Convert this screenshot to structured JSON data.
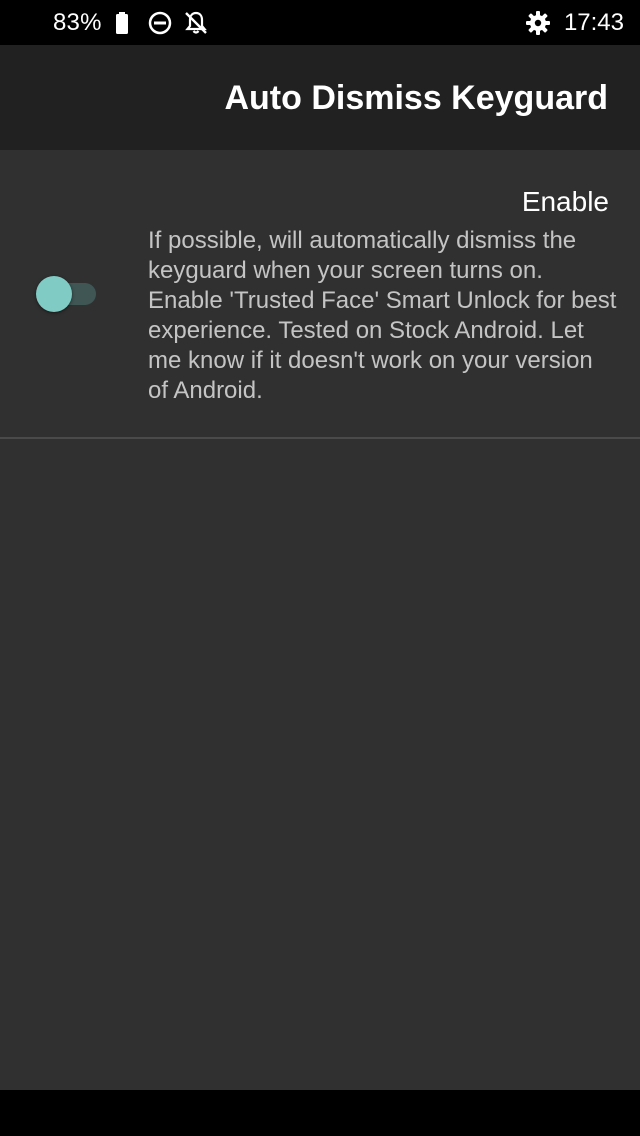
{
  "status_bar": {
    "battery_percent": "83%",
    "time": "17:43",
    "icons": [
      "battery-icon",
      "do-not-disturb-icon",
      "notifications-off-icon",
      "settings-gear-icon"
    ]
  },
  "app_bar": {
    "title": "Auto Dismiss Keyguard"
  },
  "preference": {
    "title": "Enable",
    "summary": "If possible, will automatically dismiss the keyguard when your screen turns on. Enable 'Trusted Face' Smart Unlock for best experience. Tested on Stock Android. Let me know if it doesn't work on your version of Android.",
    "switch_on": false,
    "accent_color": "#80cbc4"
  }
}
